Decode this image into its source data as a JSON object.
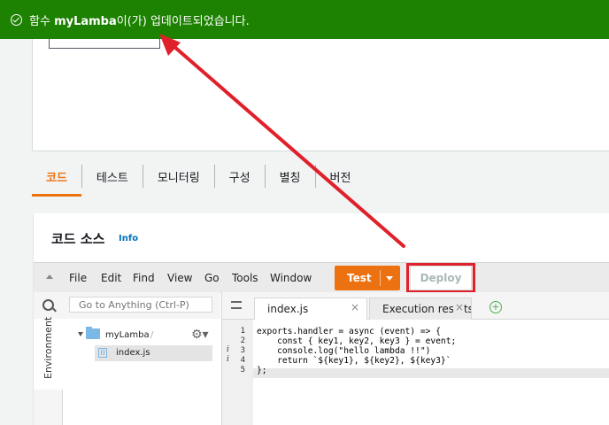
{
  "flash": {
    "prefix": "함수 ",
    "function_name": "myLamba",
    "suffix": "이(가) 업데이트되었습니다."
  },
  "tabs": [
    {
      "label": "코드",
      "active": true
    },
    {
      "label": "테스트",
      "active": false
    },
    {
      "label": "모니터링",
      "active": false
    },
    {
      "label": "구성",
      "active": false
    },
    {
      "label": "별칭",
      "active": false
    },
    {
      "label": "버전",
      "active": false
    }
  ],
  "code_source": {
    "title": "코드 소스",
    "info_link": "Info"
  },
  "ide": {
    "menu": [
      "File",
      "Edit",
      "Find",
      "View",
      "Go",
      "Tools",
      "Window"
    ],
    "test_label": "Test",
    "deploy_label": "Deploy",
    "search_placeholder": "Go to Anything (Ctrl-P)",
    "environment_label": "Environment",
    "folder_name": "myLamba",
    "folder_slash": "/",
    "file_name": "index.js",
    "editor_tabs": [
      {
        "label": "index.js",
        "active": true
      },
      {
        "label": "Execution results",
        "active": false
      }
    ],
    "line_numbers": [
      "1",
      "2",
      "3",
      "4",
      "5"
    ],
    "code_lines": [
      "exports.handler = async (event) => {",
      "    const { key1, key2, key3 } = event;",
      "    console.log(\"hello lambda !!\")",
      "    return `${key1}, ${key2}, ${key3}`",
      "};"
    ]
  },
  "colors": {
    "flash_bg": "#1d8102",
    "accent": "#ec7211",
    "annotation_red": "#e0202a",
    "link": "#0073bb"
  }
}
